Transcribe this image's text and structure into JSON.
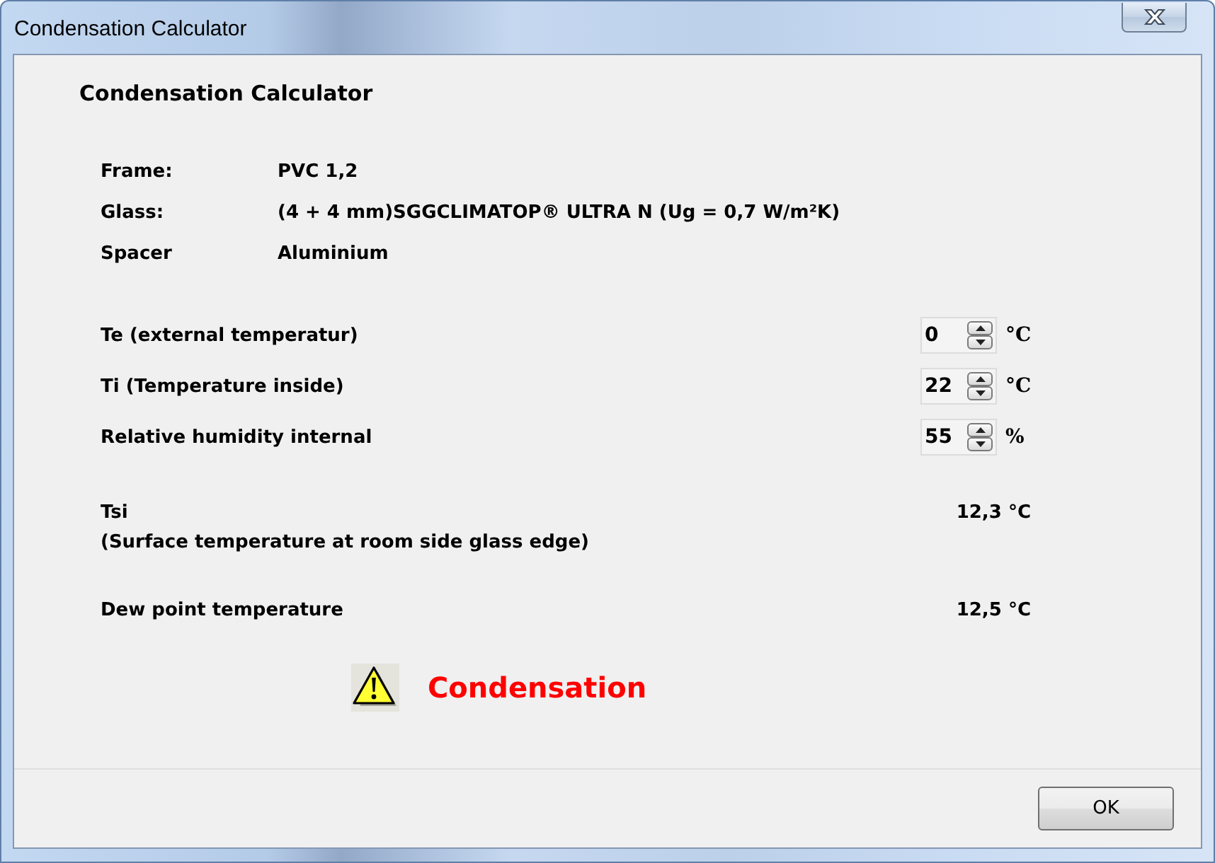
{
  "window": {
    "title": "Condensation Calculator"
  },
  "heading": "Condensation Calculator",
  "specs": [
    {
      "label": "Frame:",
      "value": "PVC 1,2"
    },
    {
      "label": "Glass:",
      "value": "(4 + 4 mm)SGGCLIMATOP® ULTRA N (Ug = 0,7 W/m²K)"
    },
    {
      "label": "Spacer",
      "value": "Aluminium"
    }
  ],
  "inputs": [
    {
      "label": "Te (external temperatur)",
      "value": "0",
      "unit": "°C"
    },
    {
      "label": "Ti (Temperature inside)",
      "value": "22",
      "unit": "°C"
    },
    {
      "label": "Relative humidity internal",
      "value": "55",
      "unit": "%"
    }
  ],
  "results": [
    {
      "label": "Tsi",
      "note": "(Surface temperature at room side glass edge)",
      "value": "12,3 °C"
    },
    {
      "label": "Dew point temperature",
      "value": "12,5 °C"
    }
  ],
  "alert": {
    "kind": "warning",
    "text": "Condensation"
  },
  "buttons": [
    {
      "label": "OK"
    }
  ]
}
